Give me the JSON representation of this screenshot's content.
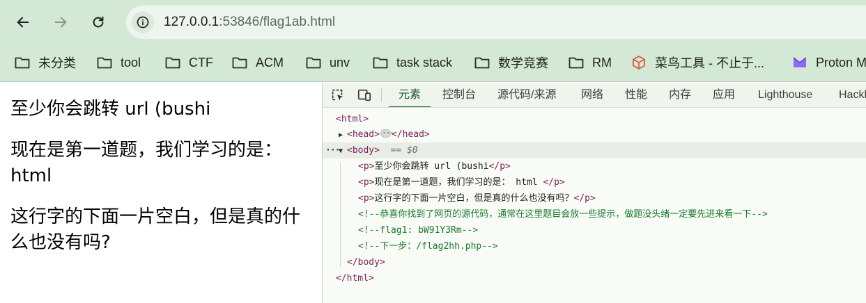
{
  "browser": {
    "url_host": "127.0.0.1",
    "url_rest": ":53846/flag1ab.html",
    "bookmarks": [
      {
        "label": "未分类",
        "icon": "folder-icon"
      },
      {
        "label": "tool",
        "icon": "folder-icon"
      },
      {
        "label": "CTF",
        "icon": "folder-icon"
      },
      {
        "label": "ACM",
        "icon": "folder-icon"
      },
      {
        "label": "unv",
        "icon": "folder-icon"
      },
      {
        "label": "task stack",
        "icon": "folder-icon"
      },
      {
        "label": "数学竞赛",
        "icon": "folder-icon"
      },
      {
        "label": "RM",
        "icon": "folder-icon"
      },
      {
        "label": "菜鸟工具 - 不止于...",
        "icon": "runoob-cube-icon"
      },
      {
        "label": "Proton M",
        "icon": "proton-logo-icon"
      }
    ],
    "colors": {
      "chrome_bg": "#d3e9d5",
      "omnibox_bg": "#eef5ee"
    }
  },
  "page": {
    "paragraphs": [
      "至少你会跳转 url (bushi",
      "现在是第一道题，我们学习的是： html",
      "这行字的下面一片空白，但是真的什么也没有吗?"
    ]
  },
  "devtools": {
    "tabs": [
      "元素",
      "控制台",
      "源代码/来源",
      "网络",
      "性能",
      "内存",
      "应用",
      "Lighthouse",
      "Hackb"
    ],
    "active_tab": "元素",
    "dom": {
      "html_open": "<html>",
      "head_open": "<head>",
      "head_close": "</head>",
      "body_open": "<body>",
      "body_eq": "== $0",
      "p_open": "<p>",
      "p_close": "</p>",
      "p1_text": "至少你会跳转 url (bushi",
      "p2_text": "现在是第一道题，我们学习的是： html ",
      "p3_text": "这行字的下面一片空白，但是真的什么也没有吗？",
      "comment1": "<!--恭喜你找到了网页的源代码，通常在这里题目会放一些提示，做题没头绪一定要先进来看一下-->",
      "comment2": "<!--flag1: bW91Y3Rm-->",
      "comment3": "<!--下一步：/flag2hh.php-->",
      "body_close": "</body>",
      "html_close": "</html>",
      "gutter_dots": "···"
    }
  }
}
